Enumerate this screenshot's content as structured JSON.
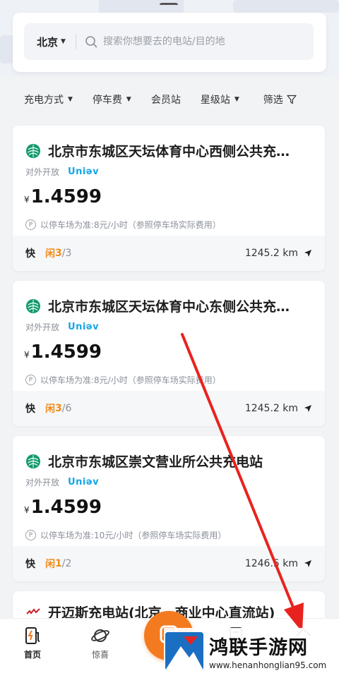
{
  "search": {
    "city": "北京",
    "placeholder": "搜索你想要去的电站/目的地"
  },
  "filters": [
    {
      "label": "充电方式",
      "has_dropdown": true
    },
    {
      "label": "停车费",
      "has_dropdown": true
    },
    {
      "label": "会员站",
      "has_dropdown": false
    },
    {
      "label": "星级站",
      "has_dropdown": true
    },
    {
      "label": "筛选",
      "icon": "filter-funnel-icon"
    }
  ],
  "stations": [
    {
      "name": "北京市东城区天坛体育中心西侧公共充…",
      "access": "对外开放",
      "brand": "Uniəv",
      "currency": "¥",
      "price": "1.4599",
      "parking": "以停车场为准:8元/小时（参照停车场实际费用）",
      "speed": "快",
      "idle_label": "闲",
      "idle_count": "3",
      "total": "/3",
      "distance": "1245.2 km"
    },
    {
      "name": "北京市东城区天坛体育中心东侧公共充…",
      "access": "对外开放",
      "brand": "Uniəv",
      "currency": "¥",
      "price": "1.4599",
      "parking": "以停车场为准:8元/小时（参照停车场实际费用）",
      "speed": "快",
      "idle_label": "闲",
      "idle_count": "3",
      "total": "/6",
      "distance": "1245.2 km"
    },
    {
      "name": "北京市东城区崇文营业所公共充电站",
      "access": "对外开放",
      "brand": "Uniəv",
      "currency": "¥",
      "price": "1.4599",
      "parking": "以停车场为准:10元/小时（参照停车场实际费用）",
      "speed": "快",
      "idle_label": "闲",
      "idle_count": "1",
      "total": "/2",
      "distance": "1246.5 km"
    },
    {
      "name": "开迈斯充电站(北京…商业中心直流站)"
    }
  ],
  "tabbar": {
    "home": "首页",
    "surprise": "惊喜"
  },
  "watermark": {
    "title": "鸿联手游网",
    "url": "www.henanhonglian95.com"
  },
  "colors": {
    "accent_orange": "#f47a1f",
    "idle_orange": "#f08c18",
    "brand_blue": "#15a5e6",
    "annotation_red": "#e8231f"
  }
}
